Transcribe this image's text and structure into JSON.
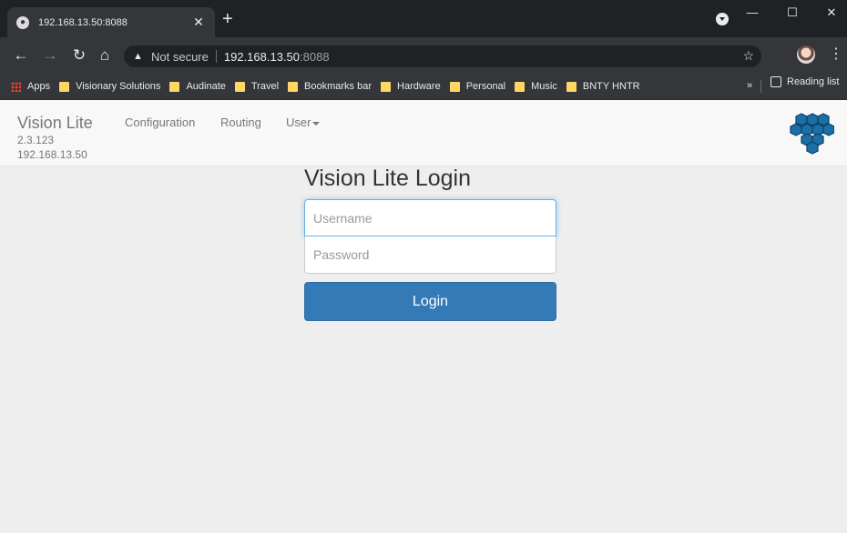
{
  "browser": {
    "tab": {
      "title": "192.168.13.50:8088"
    },
    "omnibox": {
      "security_text": "Not secure",
      "host": "192.168.13.50",
      "port": ":8088"
    },
    "bookmarks": [
      {
        "label": "Apps",
        "icon": "apps-grid-icon"
      },
      {
        "label": "Visionary Solutions",
        "icon": "folder-icon"
      },
      {
        "label": "Audinate",
        "icon": "folder-icon"
      },
      {
        "label": "Travel",
        "icon": "folder-icon"
      },
      {
        "label": "Bookmarks bar",
        "icon": "folder-icon"
      },
      {
        "label": "Hardware",
        "icon": "folder-icon"
      },
      {
        "label": "Personal",
        "icon": "folder-icon"
      },
      {
        "label": "Music",
        "icon": "folder-icon"
      },
      {
        "label": "BNTY HNTR",
        "icon": "folder-icon"
      }
    ],
    "bookmarks_overflow": "»",
    "reading_list": "Reading list"
  },
  "app": {
    "brand": "Vision Lite",
    "version": "2.3.123",
    "ip": "192.168.13.50",
    "nav": {
      "configuration": "Configuration",
      "routing": "Routing",
      "user": "User"
    },
    "logo_color": "#1a6fa6"
  },
  "login": {
    "title": "Vision Lite Login",
    "username_placeholder": "Username",
    "password_placeholder": "Password",
    "button": "Login",
    "button_color": "#337ab7"
  }
}
